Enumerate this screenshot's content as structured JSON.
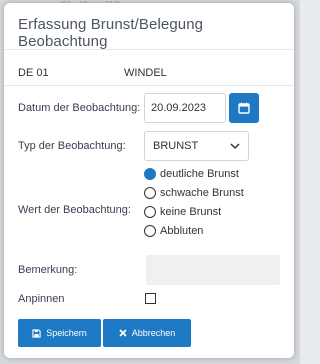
{
  "background": {
    "strip_text": "(01 · 19 von 219)"
  },
  "dialog": {
    "title": "Erfassung Brunst/Belegung Beobachtung"
  },
  "animal": {
    "id": "DE 01",
    "name": "WINDEL"
  },
  "form": {
    "date_label": "Datum der Beobachtung:",
    "date_value": "20.09.2023",
    "calendar_icon": "calendar-icon",
    "type_label": "Typ der Beobachtung:",
    "type_value": "BRUNST",
    "value_label": "Wert der Beobachtung:",
    "value_options": [
      {
        "label": "deutliche Brunst",
        "checked": true
      },
      {
        "label": "schwache Brunst",
        "checked": false
      },
      {
        "label": "keine Brunst",
        "checked": false
      },
      {
        "label": "Abbluten",
        "checked": false
      }
    ],
    "remark_label": "Bemerkung:",
    "remark_value": "",
    "pin_label": "Anpinnen",
    "pin_checked": false
  },
  "buttons": {
    "save_label": "Speichern",
    "cancel_label": "Abbrechen"
  },
  "colors": {
    "accent": "#1d79c3"
  }
}
